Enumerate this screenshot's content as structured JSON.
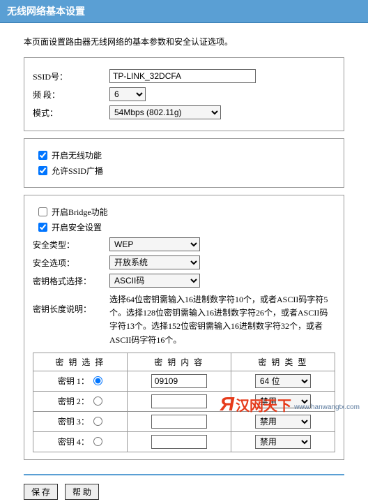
{
  "title": "无线网络基本设置",
  "intro": "本页面设置路由器无线网络的基本参数和安全认证选项。",
  "basic": {
    "ssid_label": "SSID号：",
    "ssid_value": "TP-LINK_32DCFA",
    "band_label": "频 段：",
    "band_value": "6",
    "mode_label": "模式：",
    "mode_value": "54Mbps (802.11g)"
  },
  "toggles": {
    "enable_wireless": "开启无线功能",
    "allow_ssid_broadcast": "允许SSID广播",
    "enable_bridge": "开启Bridge功能",
    "enable_security": "开启安全设置"
  },
  "security": {
    "type_label": "安全类型：",
    "type_value": "WEP",
    "option_label": "安全选项：",
    "option_value": "开放系统",
    "keyfmt_label": "密钥格式选择：",
    "keyfmt_value": "ASCII码",
    "keylen_label": "密钥长度说明：",
    "keylen_desc": "选择64位密钥需输入16进制数字符10个，或者ASCII码字符5个。选择128位密钥需输入16进制数字符26个，或者ASCII码字符13个。选择152位密钥需输入16进制数字符32个，或者ASCII码字符16个。"
  },
  "keytable": {
    "h1": "密 钥 选 择",
    "h2": "密 钥 内 容",
    "h3": "密 钥 类 型",
    "rows": [
      {
        "label": "密钥 1：",
        "selected": true,
        "content": "09109",
        "type": "64 位"
      },
      {
        "label": "密钥 2：",
        "selected": false,
        "content": "",
        "type": "禁用"
      },
      {
        "label": "密钥 3：",
        "selected": false,
        "content": "",
        "type": "禁用"
      },
      {
        "label": "密钥 4：",
        "selected": false,
        "content": "",
        "type": "禁用"
      }
    ]
  },
  "buttons": {
    "save": "保 存",
    "help": "帮 助"
  },
  "logo": {
    "cn": "汉网天下",
    "url": "www.hanwangtx.com"
  }
}
